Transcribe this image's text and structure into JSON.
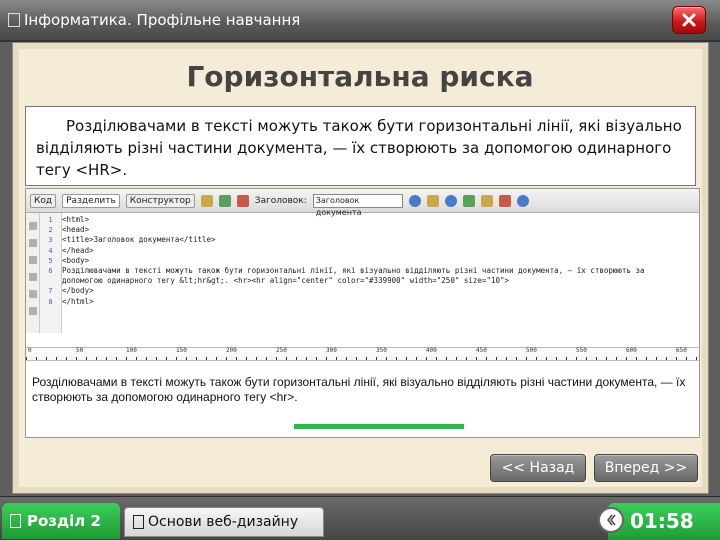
{
  "window": {
    "title": "Інформатика. Профільне навчання"
  },
  "slide": {
    "title": "Горизонтальна риска",
    "paragraph": "Розділювачами в тексті можуть також бути горизонтальні лінії, які візуально відділяють різні частини документа, — їх створюють за допомогою одинарного тегу <HR>."
  },
  "editor": {
    "toolbar": {
      "code_tab": "Код",
      "split_tab": "Разделить",
      "design_tab": "Конструктор",
      "title_label": "Заголовок:",
      "title_value": "Заголовок документа"
    },
    "line_numbers": [
      "1",
      "2",
      "3",
      "4",
      "5",
      "6",
      "",
      "7",
      "8"
    ],
    "code_lines": [
      "<html>",
      "<head>",
      "<title>Заголовок документа</title>",
      "</head>",
      "<body>",
      "Розділювачами в тексті можуть також бути горизонтальні лінії, які візуально відділяють різні частини документа, — їх створюють за",
      "допомогою одинарного тегу &lt;hr&gt;. <hr><hr align=\"center\" color=\"#339900\" width=\"250\" size=\"10\">",
      "</body>",
      "</html>"
    ],
    "ruler_labels": [
      "0",
      "50",
      "100",
      "150",
      "200",
      "250",
      "300",
      "350",
      "400",
      "450",
      "500",
      "550",
      "600",
      "650"
    ],
    "preview_text": "Розділювачами в тексті можуть також бути горизонтальні лінії, які візуально відділяють різні частини документа, — їх створюють за допомогою одинарного тегу <hr>.",
    "hr_color": "#2fb54a"
  },
  "navigation": {
    "back_label": "<< Назад",
    "next_label": "Вперед >>"
  },
  "footer": {
    "section_label": "Розділ 2",
    "course_label": "Основи веб-дизайну",
    "timer": "01:58"
  },
  "colors": {
    "accent_green": "#2fb54a",
    "close_red": "#c81616",
    "panel_bg": "#f5ecd7"
  }
}
